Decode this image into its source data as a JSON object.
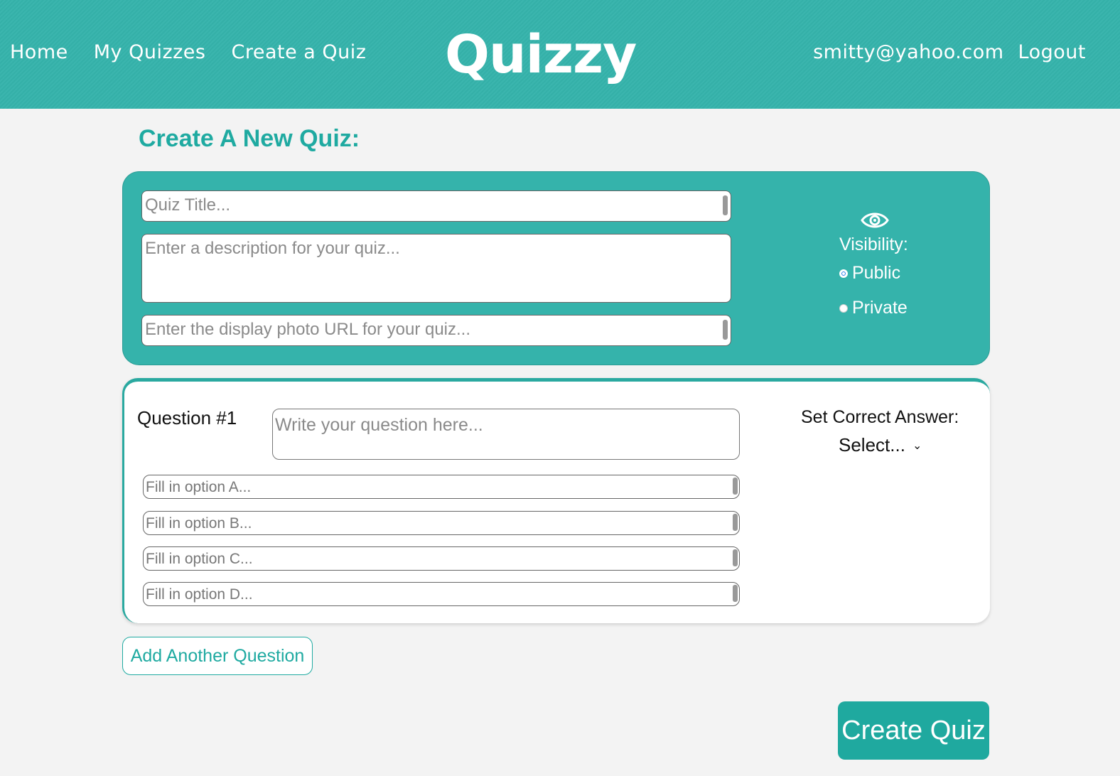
{
  "nav": {
    "links": [
      "Home",
      "My Quizzes",
      "Create a Quiz"
    ],
    "brand": "Quizzy",
    "user_email": "smitty@yahoo.com",
    "logout": "Logout"
  },
  "page": {
    "title": "Create A New Quiz:"
  },
  "quiz_meta": {
    "title_placeholder": "Quiz Title...",
    "description_placeholder": "Enter a description for your quiz...",
    "photo_placeholder": "Enter the display photo URL for your quiz...",
    "visibility_label": "Visibility:",
    "visibility_icon": "eye-icon",
    "options": [
      "Public",
      "Private"
    ],
    "selected": "Public"
  },
  "question": {
    "label": "Question #1",
    "question_placeholder": "Write your question here...",
    "option_placeholders": [
      "Fill in option A...",
      "Fill in option B...",
      "Fill in option C...",
      "Fill in option D..."
    ],
    "correct_label": "Set Correct Answer:",
    "correct_value": "Select..."
  },
  "actions": {
    "add_question": "Add Another Question",
    "create_quiz": "Create Quiz"
  },
  "colors": {
    "accent": "#35b3ab",
    "accent_dark": "#1faaa1",
    "background": "#f3f3f3"
  }
}
